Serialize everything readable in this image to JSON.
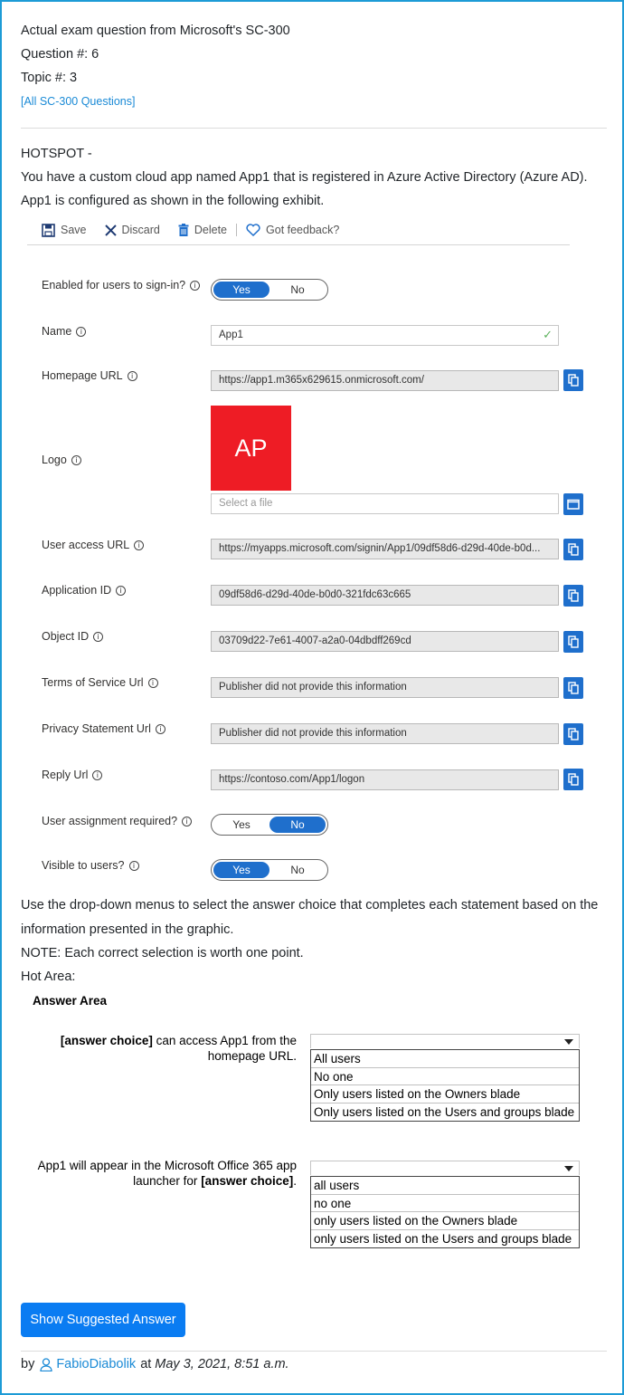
{
  "header": {
    "line1": "Actual exam question from Microsoft's SC-300",
    "question": "Question #: 6",
    "topic": "Topic #: 3",
    "all_link": "[All SC-300 Questions]"
  },
  "question": {
    "type": "HOTSPOT -",
    "line1": "You have a custom cloud app named App1 that is registered in Azure Active Directory (Azure AD).",
    "line2": "App1 is configured as shown in the following exhibit."
  },
  "exhibit": {
    "toolbar": {
      "save": "Save",
      "discard": "Discard",
      "delete": "Delete",
      "feedback": "Got feedback?"
    },
    "enabled": {
      "label": "Enabled for users to sign-in?",
      "yes": "Yes",
      "no": "No",
      "selected": "Yes"
    },
    "name": {
      "label": "Name",
      "value": "App1"
    },
    "homepage": {
      "label": "Homepage URL",
      "value": "https://app1.m365x629615.onmicrosoft.com/"
    },
    "logo": {
      "label": "Logo",
      "text": "AP",
      "color": "#ee1c25",
      "placeholder": "Select a file"
    },
    "user_access": {
      "label": "User access URL",
      "value": "https://myapps.microsoft.com/signin/App1/09df58d6-d29d-40de-b0d..."
    },
    "app_id": {
      "label": "Application ID",
      "value": "09df58d6-d29d-40de-b0d0-321fdc63c665"
    },
    "object_id": {
      "label": "Object ID",
      "value": "03709d22-7e61-4007-a2a0-04dbdff269cd"
    },
    "tos": {
      "label": "Terms of Service Url",
      "value": "Publisher did not provide this information"
    },
    "privacy": {
      "label": "Privacy Statement Url",
      "value": "Publisher did not provide this information"
    },
    "reply": {
      "label": "Reply Url",
      "value": "https://contoso.com/App1/logon"
    },
    "assignment": {
      "label": "User assignment required?",
      "yes": "Yes",
      "no": "No",
      "selected": "No"
    },
    "visible": {
      "label": "Visible to users?",
      "yes": "Yes",
      "no": "No",
      "selected": "Yes"
    },
    "accent": "#1f6fcc"
  },
  "instructions": {
    "line1": "Use the drop-down menus to select the answer choice that completes each statement based on the",
    "line2": "information presented in the graphic.",
    "note": "NOTE: Each correct selection is worth one point.",
    "hot_area": "Hot Area:"
  },
  "answer_area": {
    "title": "Answer Area",
    "q1": {
      "bold": "[answer choice]",
      "rest1": " can access App1 from the",
      "rest2": "homepage URL.",
      "options": [
        "All users",
        "No one",
        "Only users listed on the Owners blade",
        "Only users listed on the Users and groups blade"
      ]
    },
    "q2": {
      "line1": "App1 will appear in the Microsoft Office 365 app",
      "pre": "launcher for ",
      "bold": "[answer choice]",
      "post": ".",
      "options": [
        "all users",
        "no one",
        "only users listed on the Owners blade",
        "only users listed on the Users and groups blade"
      ]
    }
  },
  "button": {
    "label": "Show Suggested Answer",
    "color": "#0a7cf2"
  },
  "footer": {
    "by": "by",
    "user": "FabioDiabolik",
    "at": "at",
    "date": "May 3, 2021, 8:51 a.m."
  }
}
